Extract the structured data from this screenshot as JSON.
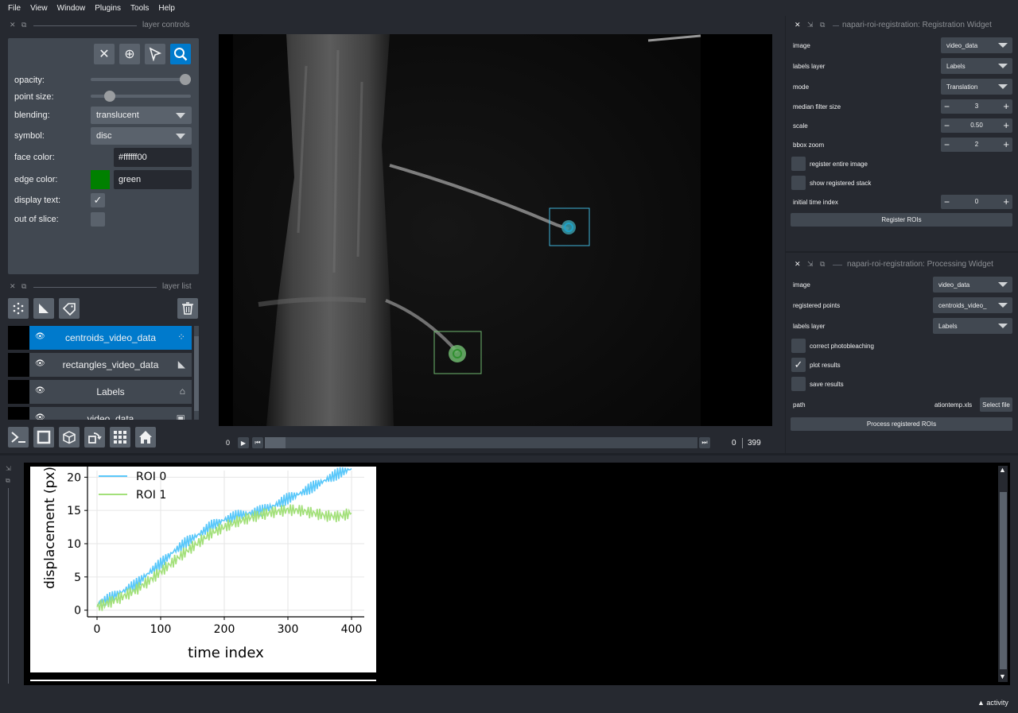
{
  "menu": [
    "File",
    "View",
    "Window",
    "Plugins",
    "Tools",
    "Help"
  ],
  "layer_controls": {
    "title": "layer controls",
    "opacity_label": "opacity:",
    "opacity_value": 1.0,
    "point_size_label": "point size:",
    "point_size_value": 0.15,
    "blending_label": "blending:",
    "blending_value": "translucent",
    "symbol_label": "symbol:",
    "symbol_value": "disc",
    "face_color_label": "face color:",
    "face_color_value": "#ffffff00",
    "edge_color_label": "edge color:",
    "edge_color_value": "green",
    "edge_swatch_color": "#008000",
    "display_text_label": "display text:",
    "display_text_checked": true,
    "out_of_slice_label": "out of slice:",
    "out_of_slice_checked": false
  },
  "layer_list": {
    "title": "layer list",
    "layers": [
      {
        "name": "centroids_video_data",
        "type_icon": "points-icon",
        "selected": true
      },
      {
        "name": "rectangles_video_data",
        "type_icon": "shapes-icon",
        "selected": false
      },
      {
        "name": "Labels",
        "type_icon": "labels-icon",
        "selected": false
      },
      {
        "name": "video_data",
        "type_icon": "image-icon",
        "selected": false
      }
    ]
  },
  "dims_slider": {
    "axis_label": "0",
    "current": "0",
    "max": "399"
  },
  "registration_widget": {
    "title": "napari-roi-registration: Registration Widget",
    "image_label": "image",
    "image_value": "video_data",
    "labels_layer_label": "labels layer",
    "labels_layer_value": "Labels",
    "mode_label": "mode",
    "mode_value": "Translation",
    "median_filter_label": "median filter size",
    "median_filter_value": "3",
    "scale_label": "scale",
    "scale_value": "0.50",
    "bbox_zoom_label": "bbox zoom",
    "bbox_zoom_value": "2",
    "register_entire_label": "register entire image",
    "show_registered_label": "show registered stack",
    "initial_time_label": "initial time index",
    "initial_time_value": "0",
    "register_button": "Register ROIs"
  },
  "processing_widget": {
    "title": "napari-roi-registration: Processing Widget",
    "image_label": "image",
    "image_value": "video_data",
    "registered_points_label": "registered points",
    "registered_points_value": "centroids_video_",
    "labels_layer_label": "labels layer",
    "labels_layer_value": "Labels",
    "correct_photobleaching_label": "correct photobleaching",
    "plot_results_label": "plot results",
    "plot_results_checked": true,
    "save_results_label": "save results",
    "path_label": "path",
    "path_value": "ationtemp.xls",
    "select_file_button": "Select file",
    "process_button": "Process registered ROIs"
  },
  "status": {
    "activity_label": "activity"
  },
  "chart_data": {
    "type": "line",
    "xlabel": "time index",
    "ylabel": "displacement (px)",
    "xlim": [
      -15,
      420
    ],
    "ylim": [
      -1,
      21
    ],
    "xticks": [
      0,
      100,
      200,
      300,
      400
    ],
    "yticks": [
      0,
      5,
      10,
      15,
      20
    ],
    "grid": true,
    "legend": "top-left",
    "series": [
      {
        "name": "ROI 0",
        "color": "#5ac8fa",
        "x": [
          0,
          20,
          40,
          60,
          80,
          100,
          120,
          140,
          160,
          180,
          200,
          220,
          240,
          260,
          280,
          300,
          320,
          340,
          360,
          380,
          400
        ],
        "values": [
          0.8,
          1.8,
          2.8,
          3.8,
          5.5,
          7.0,
          8.8,
          10.2,
          11.4,
          12.7,
          13.6,
          14.2,
          14.6,
          15.0,
          15.8,
          16.8,
          17.6,
          18.6,
          19.6,
          20.6,
          21.3
        ]
      },
      {
        "name": "ROI 1",
        "color": "#a3e07a",
        "x": [
          0,
          20,
          40,
          60,
          80,
          100,
          120,
          140,
          160,
          180,
          200,
          220,
          240,
          260,
          280,
          300,
          320,
          340,
          360,
          380,
          400
        ],
        "values": [
          0.5,
          1.2,
          2.0,
          3.0,
          4.3,
          5.8,
          7.3,
          8.8,
          10.2,
          11.6,
          12.5,
          13.3,
          13.9,
          14.4,
          14.8,
          15.1,
          15.0,
          14.6,
          14.2,
          14.1,
          14.6
        ]
      }
    ]
  }
}
